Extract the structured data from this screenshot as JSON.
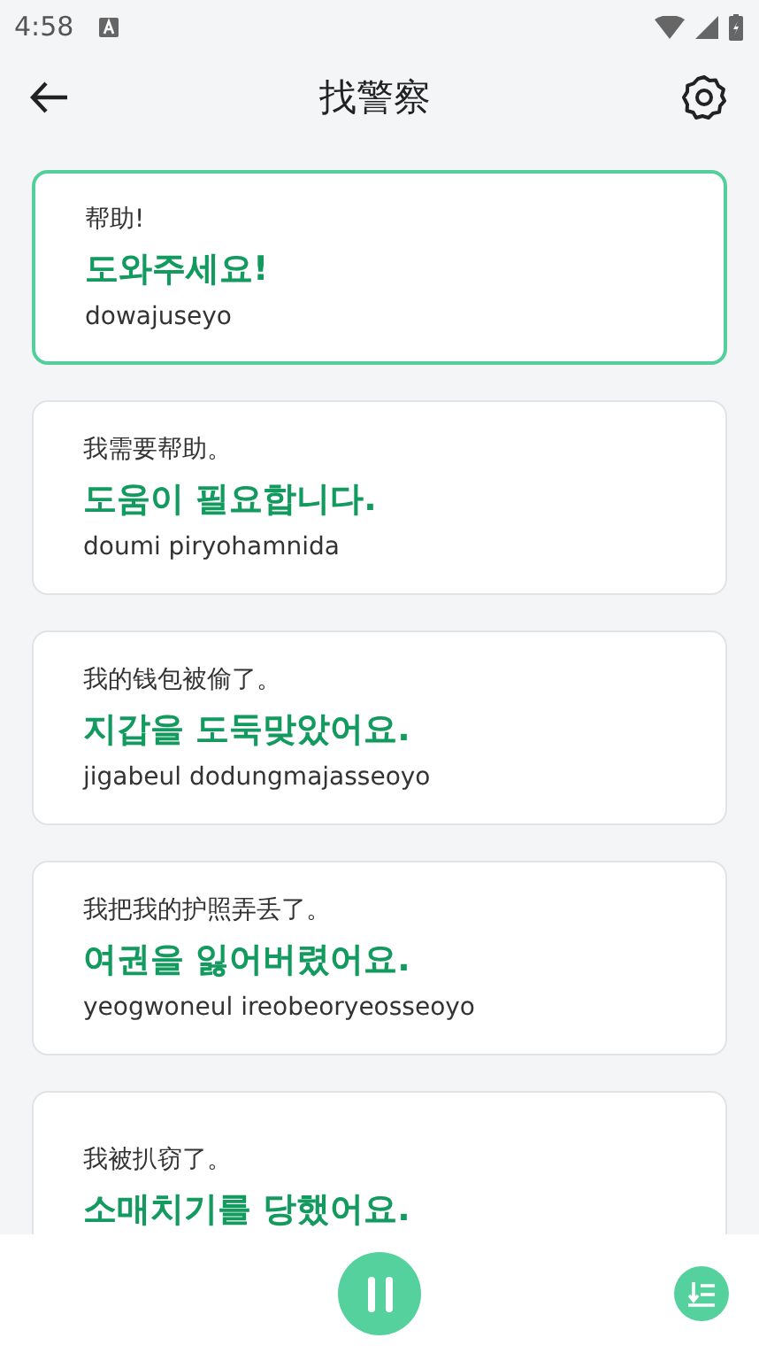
{
  "status_bar": {
    "time": "4:58"
  },
  "header": {
    "title": "找警察"
  },
  "phrases": [
    {
      "chinese": "帮助!",
      "korean": "도와주세요!",
      "romanization": "dowajuseyo",
      "selected": true
    },
    {
      "chinese": "我需要帮助。",
      "korean": "도움이 필요합니다.",
      "romanization": "doumi piryohamnida",
      "selected": false
    },
    {
      "chinese": "我的钱包被偷了。",
      "korean": "지갑을 도둑맞았어요.",
      "romanization": "jigabeul dodungmajasseoyo",
      "selected": false
    },
    {
      "chinese": "我把我的护照弄丢了。",
      "korean": "여권을 잃어버렸어요.",
      "romanization": "yeogwoneul ireobeoryeosseoyo",
      "selected": false
    },
    {
      "chinese": "我被扒窃了。",
      "korean": "소매치기를 당했어요."
    }
  ]
}
